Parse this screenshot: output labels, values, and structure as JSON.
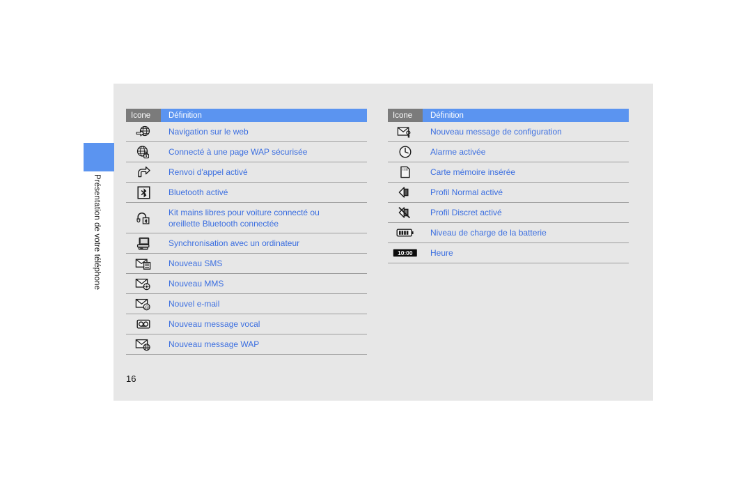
{
  "document": {
    "chapter_label": "Présentation de votre téléphone",
    "page_number": "16"
  },
  "colors": {
    "accent_blue": "#5b94f0",
    "text_blue": "#3c6fe0",
    "header_gray": "#7b7b7b",
    "page_bg": "#e7e7e7",
    "rule": "#9d9d9d"
  },
  "tables": {
    "left": {
      "header": {
        "icon_col": "Icone",
        "def_col": "Définition"
      },
      "rows": [
        {
          "icon": "globe-web-icon",
          "definition": "Navigation sur le web"
        },
        {
          "icon": "globe-lock-icon",
          "definition": "Connecté à une page WAP sécurisée"
        },
        {
          "icon": "call-forward-arrow-icon",
          "definition": "Renvoi d'appel activé"
        },
        {
          "icon": "bluetooth-icon",
          "definition": "Bluetooth activé"
        },
        {
          "icon": "headset-bluetooth-icon",
          "definition": "Kit mains libres pour voiture connecté ou",
          "definition_line2": "oreillette Bluetooth connectée"
        },
        {
          "icon": "computer-sync-icon",
          "definition": "Synchronisation avec un ordinateur"
        },
        {
          "icon": "envelope-sms-icon",
          "definition": "Nouveau SMS"
        },
        {
          "icon": "envelope-mms-icon",
          "definition": "Nouveau MMS"
        },
        {
          "icon": "envelope-email-icon",
          "definition": "Nouvel e-mail"
        },
        {
          "icon": "voicemail-icon",
          "definition": "Nouveau message vocal"
        },
        {
          "icon": "envelope-wap-icon",
          "definition": "Nouveau message WAP"
        }
      ]
    },
    "right": {
      "header": {
        "icon_col": "Icone",
        "def_col": "Définition"
      },
      "rows": [
        {
          "icon": "envelope-config-icon",
          "definition": "Nouveau message de configuration"
        },
        {
          "icon": "alarm-clock-icon",
          "definition": "Alarme activée"
        },
        {
          "icon": "memory-card-icon",
          "definition": "Carte mémoire insérée"
        },
        {
          "icon": "speaker-on-icon",
          "definition": "Profil Normal activé"
        },
        {
          "icon": "speaker-mute-icon",
          "definition": "Profil Discret activé"
        },
        {
          "icon": "battery-icon",
          "definition": "Niveau de charge de la batterie"
        },
        {
          "icon": "clock-time-icon",
          "definition": "Heure",
          "icon_text": "10:00"
        }
      ]
    }
  }
}
